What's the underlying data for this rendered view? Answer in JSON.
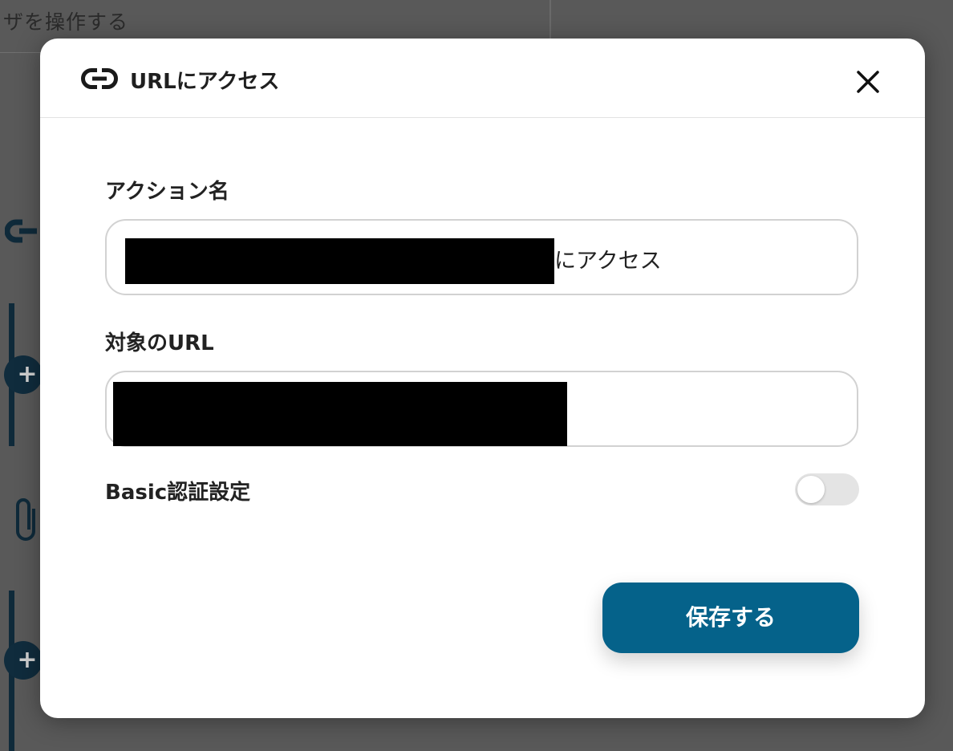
{
  "background": {
    "header_text": "ザを操作する"
  },
  "modal": {
    "title": "URLにアクセス",
    "title_icon": "link-icon",
    "close_icon": "close-icon",
    "fields": {
      "action_name": {
        "label": "アクション名",
        "value_suffix": "にアクセス"
      },
      "target_url": {
        "label": "対象のURL"
      },
      "basic_auth": {
        "label": "Basic認証設定",
        "enabled": false
      }
    },
    "save_label": "保存する"
  },
  "colors": {
    "primary_button": "#05628a",
    "backdrop": "#595959",
    "toggle_off": "#e4e4e4"
  }
}
